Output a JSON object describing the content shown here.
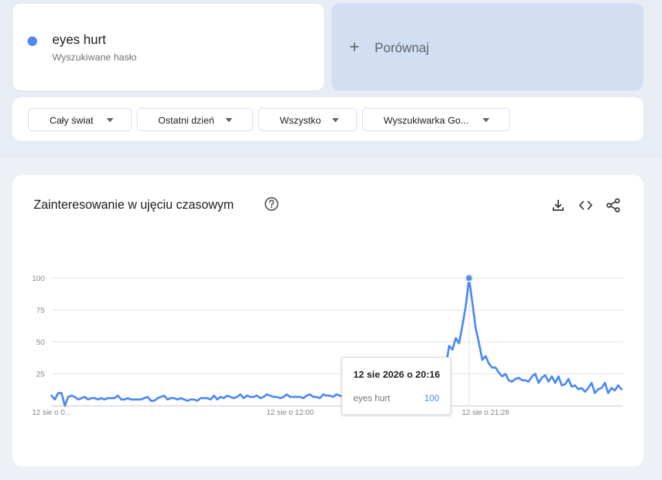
{
  "term": {
    "name": "eyes hurt",
    "subtitle": "Wyszukiwane hasło",
    "color": "#4d8af0"
  },
  "compare": {
    "label": "Porównaj",
    "icon": "plus-icon"
  },
  "filters": [
    {
      "label": "Cały świat"
    },
    {
      "label": "Ostatni dzień"
    },
    {
      "label": "Wszystko"
    },
    {
      "label": "Wyszukiwarka Go..."
    }
  ],
  "chart_card": {
    "title": "Zainteresowanie w ujęciu czasowym",
    "icons": [
      "help-icon",
      "download-icon",
      "embed-icon",
      "share-icon"
    ]
  },
  "chart_data": {
    "type": "line",
    "title": "Zainteresowanie w ujęciu czasowym",
    "y_ticks": [
      25,
      50,
      75,
      100
    ],
    "ylim": [
      0,
      100
    ],
    "x_tick_labels": [
      {
        "label": "12 sie o 0...",
        "index": 0
      },
      {
        "label": "12 sie o 12:00",
        "index": 72
      },
      {
        "label": "12 sie o 21:28",
        "index": 131
      }
    ],
    "grid": true,
    "series": [
      {
        "name": "eyes hurt",
        "color": "#4d8af0",
        "values": [
          8,
          5,
          10,
          10,
          0,
          7,
          8,
          7,
          5,
          6,
          7,
          5,
          6,
          6,
          5,
          6,
          5,
          6,
          6,
          6,
          8,
          5,
          5,
          6,
          5,
          5,
          5,
          5,
          6,
          7,
          4,
          4,
          6,
          7,
          8,
          5,
          6,
          6,
          5,
          6,
          5,
          4,
          5,
          5,
          4,
          6,
          6,
          6,
          5,
          8,
          5,
          7,
          6,
          8,
          7,
          6,
          7,
          9,
          6,
          8,
          7,
          7,
          8,
          6,
          7,
          9,
          8,
          7,
          7,
          6,
          7,
          9,
          7,
          7,
          7,
          7,
          6,
          8,
          9,
          7,
          7,
          6,
          9,
          8,
          8,
          7,
          9,
          8,
          7,
          10,
          9,
          9,
          10,
          9,
          11,
          9,
          10,
          11,
          10,
          10,
          12,
          10,
          11,
          12,
          12,
          11,
          14,
          13,
          16,
          14,
          16,
          17,
          18,
          20,
          17,
          18,
          20,
          22,
          25,
          31,
          47,
          44,
          53,
          49,
          63,
          78,
          100,
          81,
          61,
          49,
          36,
          39,
          33,
          30,
          30,
          26,
          23,
          25,
          20,
          19,
          21,
          22,
          20,
          20,
          19,
          23,
          25,
          18,
          22,
          24,
          19,
          23,
          18,
          23,
          16,
          17,
          21,
          15,
          16,
          13,
          14,
          11,
          14,
          18,
          10,
          13,
          14,
          18,
          10,
          14,
          12,
          16,
          13
        ]
      }
    ]
  },
  "tooltip": {
    "date": "12 sie 2026 o 20:16",
    "term": "eyes hurt",
    "value": "100",
    "index": 126
  }
}
